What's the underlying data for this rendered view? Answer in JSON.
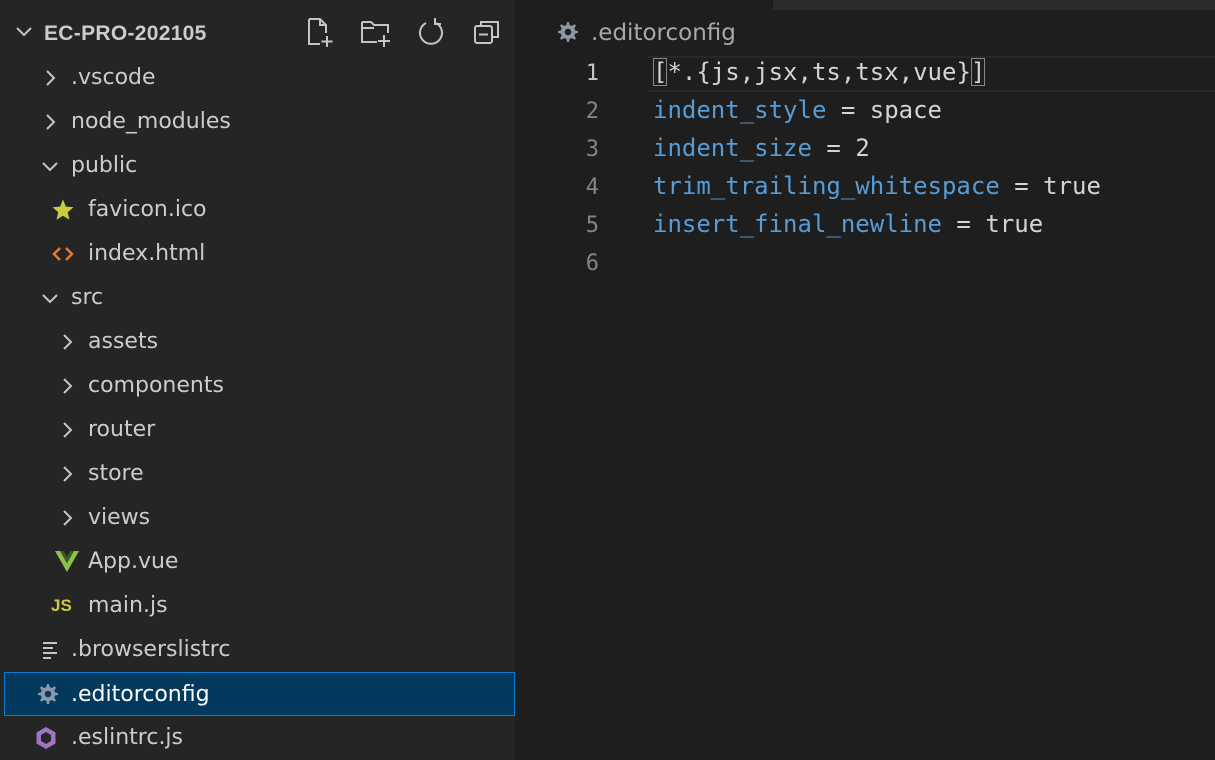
{
  "explorer": {
    "project_title": "EC-PRO-202105",
    "actions": [
      "new-file",
      "new-folder",
      "refresh",
      "collapse-all"
    ],
    "items": [
      {
        "label": ".vscode",
        "type": "folder",
        "expanded": false,
        "depth": 0
      },
      {
        "label": "node_modules",
        "type": "folder",
        "expanded": false,
        "depth": 0
      },
      {
        "label": "public",
        "type": "folder",
        "expanded": true,
        "depth": 0
      },
      {
        "label": "favicon.ico",
        "type": "file",
        "icon": "star-icon",
        "depth": 1
      },
      {
        "label": "index.html",
        "type": "file",
        "icon": "html-icon",
        "depth": 1
      },
      {
        "label": "src",
        "type": "folder",
        "expanded": true,
        "depth": 0
      },
      {
        "label": "assets",
        "type": "folder",
        "expanded": false,
        "depth": 1
      },
      {
        "label": "components",
        "type": "folder",
        "expanded": false,
        "depth": 1
      },
      {
        "label": "router",
        "type": "folder",
        "expanded": false,
        "depth": 1
      },
      {
        "label": "store",
        "type": "folder",
        "expanded": false,
        "depth": 1
      },
      {
        "label": "views",
        "type": "folder",
        "expanded": false,
        "depth": 1
      },
      {
        "label": "App.vue",
        "type": "file",
        "icon": "vue-icon",
        "depth": 1
      },
      {
        "label": "main.js",
        "type": "file",
        "icon": "js-icon",
        "icon_text": "JS",
        "depth": 1
      },
      {
        "label": ".browserslistrc",
        "type": "file",
        "icon": "lines-icon",
        "depth": 0
      },
      {
        "label": ".editorconfig",
        "type": "file",
        "icon": "gear-icon",
        "depth": 0,
        "selected": true
      },
      {
        "label": ".eslintrc.js",
        "type": "file",
        "icon": "eslint-icon",
        "depth": 0
      }
    ]
  },
  "editor": {
    "breadcrumb": ".editorconfig",
    "active_line": 1,
    "lines": [
      {
        "num": "1",
        "open": "[",
        "body": "*.{js,jsx,ts,tsx,vue}",
        "close": "]"
      },
      {
        "num": "2",
        "key": "indent_style",
        "eq": " = ",
        "value": "space"
      },
      {
        "num": "3",
        "key": "indent_size",
        "eq": " = ",
        "value": "2"
      },
      {
        "num": "4",
        "key": "trim_trailing_whitespace",
        "eq": " = ",
        "value": "true"
      },
      {
        "num": "5",
        "key": "insert_final_newline",
        "eq": " = ",
        "value": "true"
      },
      {
        "num": "6"
      }
    ]
  },
  "colors": {
    "sidebar_bg": "#252526",
    "editor_bg": "#1e1e1e",
    "selection_bg": "#04395e",
    "selection_border": "#007fd4",
    "key": "#569cd6",
    "text": "#d4d4d4",
    "star": "#cbcb41",
    "html": "#e37933",
    "vue": "#8dc149",
    "js": "#cbcb41",
    "eslint": "#a074c4"
  }
}
